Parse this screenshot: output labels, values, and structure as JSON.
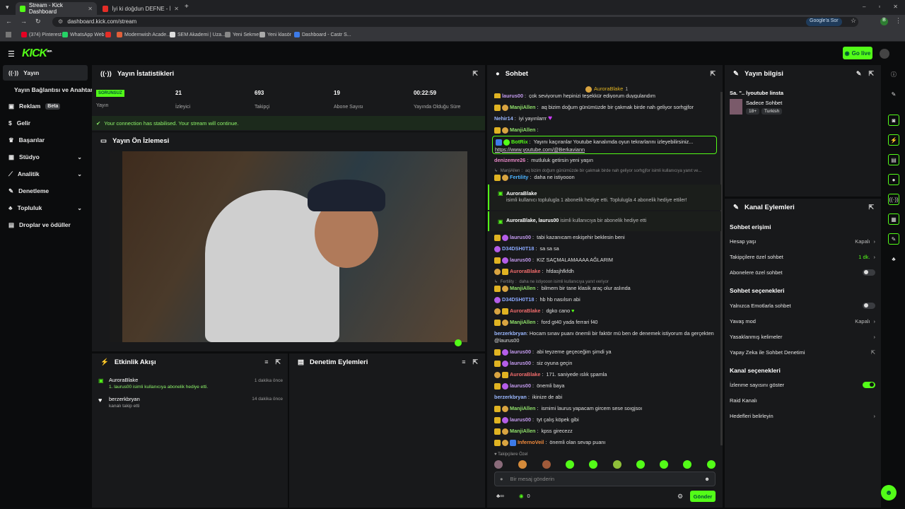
{
  "browser": {
    "tabs": [
      {
        "title": "Stream - Kick Dashboard"
      },
      {
        "title": "İyi ki doğdun DEFNE - İsme Öz"
      }
    ],
    "url": "dashboard.kick.com/stream",
    "google_ask": "Google'a Sor",
    "bookmarks": [
      "(374) Pinterest",
      "WhatsApp Web",
      "Modernwish Acade...",
      "SEM Akademi | Uza...",
      "Yeni Sekme",
      "Yeni klasör",
      "Dashboard - Castr S..."
    ]
  },
  "header": {
    "logo": "KICK",
    "logo_sup": "BETA",
    "go_live": "Go live"
  },
  "sidebar": {
    "items": [
      {
        "label": "Yayın",
        "icon": "broadcast-icon"
      },
      {
        "label": "Yayın Bağlantısı ve Anahtarı"
      },
      {
        "label": "Reklam",
        "badge": "Beta",
        "icon": "megaphone-icon"
      },
      {
        "label": "Gelir",
        "icon": "dollar-icon"
      },
      {
        "label": "Başarılar",
        "icon": "trophy-icon"
      },
      {
        "label": "Stüdyo",
        "icon": "studio-icon"
      },
      {
        "label": "Analitik",
        "icon": "chart-icon"
      },
      {
        "label": "Denetleme",
        "icon": "wrench-icon"
      },
      {
        "label": "Topluluk",
        "icon": "users-icon"
      },
      {
        "label": "Droplar ve ödüller",
        "icon": "gift-icon"
      }
    ]
  },
  "stats": {
    "title": "Yayın İstatistikleri",
    "status_badge": "SORUNSUZ",
    "status_label": "Yayın",
    "viewers": "21",
    "viewers_label": "İzleyici",
    "followers": "693",
    "followers_label": "Takipçi",
    "subs": "19",
    "subs_label": "Abone Sayısı",
    "uptime": "00:22:59",
    "uptime_label": "Yayında Olduğu Süre",
    "connection": "Your connection has stabilised. Your stream will continue."
  },
  "preview": {
    "title": "Yayın Ön İzlemesi"
  },
  "activity": {
    "title": "Etkinlik Akışı",
    "items": [
      {
        "name": "AuroraBlake",
        "detail": "1. laurus00 isimli kullanıcıya abonelik hediye etti.",
        "time": "1 dakika önce"
      },
      {
        "name": "berzerkbryan",
        "detail": "kanalı takip etti",
        "time": "14 dakika önce"
      }
    ]
  },
  "moderation": {
    "title": "Denetim Eylemleri"
  },
  "chat": {
    "title": "Sohbet",
    "pinned": "AuroraBlake",
    "pinned_count": "1",
    "lines": [
      {
        "user": "laurus00",
        "text": "çok seviyorum hepinizi teşekkür ediyorum duygulandım",
        "color": "#c59cf0"
      },
      {
        "user": "ManjiAllen",
        "text": "aq bizim doğum günümüzde bir çakmak birde nah geliyor sorhgjfor",
        "color": "#8fe06a"
      },
      {
        "user": "Nehir14",
        "text": "iyi yayınlarrr",
        "color": "#9bb8ff"
      },
      {
        "user": "ManjiAllen",
        "text": "",
        "color": "#8fe06a"
      },
      {
        "user": "BotRix",
        "text": "Yayını kaçıranlar Youtube kanalımda oyun tekrarlarını izleyebilirsiniz...",
        "link": "https://www.youtube.com/@Berkaviann",
        "color": "#53fc18"
      },
      {
        "user": "denizemre26",
        "text": "mutluluk getirsin yeni yaşın",
        "color": "#e889c8"
      },
      {
        "user": "ManjiAllen",
        "text": "aq bizim doğum günümüzde bir çakmak birde nah geliyor sorhgjfor isimli kullanıcıya yanıt ve...",
        "color": "#888",
        "sys": true
      },
      {
        "user": "Fertility",
        "text": "daha ne istiyooon",
        "color": "#4bb3ff"
      }
    ],
    "gift1": {
      "user": "AuroraBlake",
      "text": "isimli kullanıcı toplulugla 1 abonelik hediye etti. Toplulugla 4 abonelik hediye ettiler!"
    },
    "gift2": {
      "users": "AuroraBlake, laurus00",
      "text": "isimli kullanıcıya bir abonelik hediye etti"
    },
    "lines2": [
      {
        "user": "laurus00",
        "text": "tabi kazanıcam eskişehir beklesin beni",
        "color": "#c59cf0"
      },
      {
        "user": "D34DSH0T18",
        "text": "sa sa sa",
        "color": "#8aa8ff"
      },
      {
        "user": "laurus00",
        "text": "KIZ SAÇMALAMAAAA AĞLARIM",
        "color": "#c59cf0"
      },
      {
        "user": "AuroraBlake",
        "text": "hfdasjhfkfdh",
        "color": "#ef6b6b"
      },
      {
        "user": "Fertility",
        "text": "daha ne istiyooon isimli kullanıcıya yanıt veriyor",
        "color": "#888",
        "sys": true
      },
      {
        "user": "ManjiAllen",
        "text": "bilmem bir tane klasik araç olur aslında",
        "color": "#8fe06a"
      },
      {
        "user": "D34DSH0T18",
        "text": "hb hb nasılsın abi",
        "color": "#8aa8ff"
      },
      {
        "user": "AuroraBlake",
        "text": "dgko cano",
        "color": "#ef6b6b"
      },
      {
        "user": "ManjiAllen",
        "text": "ford gt40 yada ferrari f40",
        "color": "#8fe06a"
      },
      {
        "user": "berzerkbryan",
        "text": "Hocam sınav puanı önemli bir faktör mü ben de denemek istiyorum da gerçekten @laurus00",
        "color": "#9bb8ff"
      },
      {
        "user": "laurus00",
        "text": "abi teyzeme geçeceğim şimdi ya",
        "color": "#c59cf0"
      },
      {
        "user": "laurus00",
        "text": "siz oyuna geçin",
        "color": "#c59cf0"
      },
      {
        "user": "AuroraBlake",
        "text": "171. saniyede ıslık şpamla",
        "color": "#ef6b6b"
      },
      {
        "user": "laurus00",
        "text": "önemli baya",
        "color": "#c59cf0"
      },
      {
        "user": "berzerkbryan",
        "text": "ikinize de abi",
        "color": "#9bb8ff"
      },
      {
        "user": "ManjiAllen",
        "text": "ismimi laurus yapacam gircem sese soıgjsoı",
        "color": "#8fe06a"
      },
      {
        "user": "laurus00",
        "text": "tyt çalış köpek gibi",
        "color": "#c59cf0"
      },
      {
        "user": "ManjiAllen",
        "text": "kpss girecezz",
        "color": "#8fe06a"
      },
      {
        "user": "InfernoVeil",
        "text": "önemli olan sevap puanı",
        "color": "#f08a3c"
      }
    ],
    "followers_only": "Takipçilere Özel",
    "input_placeholder": "Bir mesaj gönderin",
    "count": "0",
    "send": "Gönder"
  },
  "info": {
    "title": "Yayın bilgisi",
    "stream_title": "Sa. \".. lyoutube linsta",
    "category": "Sadece Sohbet",
    "tags": [
      "18+",
      "Turkish"
    ]
  },
  "channel": {
    "title": "Kanal Eylemleri",
    "chat_access": "Sohbet erişimi",
    "account_age": "Hesap yaşı",
    "account_age_val": "Kapalı",
    "followers_chat": "Takipçilere özel sohbet",
    "followers_chat_val": "1 dk.",
    "subs_chat": "Abonelere özel sohbet",
    "chat_options": "Sohbet seçenekleri",
    "emotes_only": "Yalnızca Emotlarla sohbet",
    "slow_mode": "Yavaş mod",
    "slow_mode_val": "Kapalı",
    "banned_words": "Yasaklanmış kelimeler",
    "ai_mod": "Yapay Zeka ile Sohbet Denetimi",
    "channel_options": "Kanal seçenekleri",
    "show_viewers": "İzlenme sayısını göster",
    "raid": "Raid Kanalı",
    "targets": "Hedefleri belirleyin"
  },
  "colors": {
    "accent": "#53fc18",
    "panel": "#18191b",
    "background": "#0b0c0d"
  }
}
